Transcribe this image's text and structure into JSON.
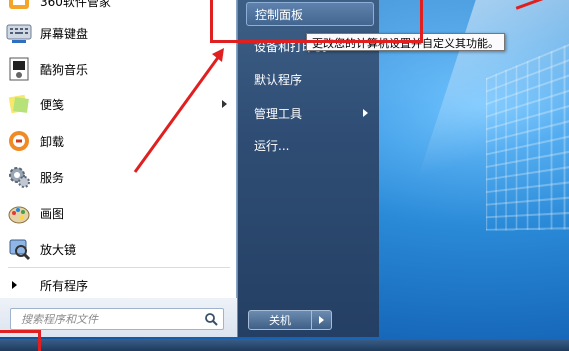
{
  "start_menu": {
    "programs": [
      {
        "label": "360软件管家",
        "icon": "software-manager-icon",
        "arrow": false
      },
      {
        "label": "屏幕键盘",
        "icon": "keyboard-icon",
        "arrow": false
      },
      {
        "label": "酷狗音乐",
        "icon": "music-player-icon",
        "arrow": false
      },
      {
        "label": "便笺",
        "icon": "sticky-notes-icon",
        "arrow": true
      },
      {
        "label": "卸载",
        "icon": "uninstall-icon",
        "arrow": false
      },
      {
        "label": "服务",
        "icon": "services-gear-icon",
        "arrow": false
      },
      {
        "label": "画图",
        "icon": "paint-icon",
        "arrow": false
      },
      {
        "label": "放大镜",
        "icon": "magnifier-icon",
        "arrow": false
      }
    ],
    "all_programs_label": "所有程序",
    "search_placeholder": "搜索程序和文件",
    "right_items": [
      {
        "label": "控制面板",
        "highlighted": true,
        "arrow": false
      },
      {
        "label": "设备和打印机",
        "highlighted": false,
        "arrow": false
      },
      {
        "label": "默认程序",
        "highlighted": false,
        "arrow": false
      },
      {
        "label": "管理工具",
        "highlighted": false,
        "arrow": true
      },
      {
        "label": "运行...",
        "highlighted": false,
        "arrow": false
      }
    ],
    "shutdown_label": "关机",
    "tooltip": "更改您的计算机设置并自定义其功能。"
  },
  "colors": {
    "annotation_red": "#e02020",
    "right_pane": "#2f4d74",
    "desktop_blue": "#1a78c8"
  }
}
